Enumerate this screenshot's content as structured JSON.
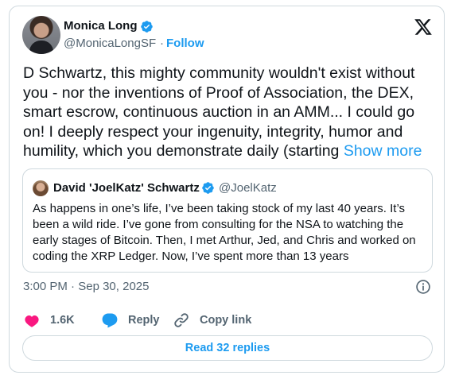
{
  "author": {
    "name": "Monica Long",
    "handle": "@MonicaLongSF",
    "separator": "·",
    "follow_label": "Follow"
  },
  "tweet": {
    "text": "D Schwartz, this mighty community wouldn't exist without you - nor the inventions of Proof of Association, the DEX, smart escrow, continuous auction in an AMM... I could go on! I deeply respect your ingenuity, integrity, humor and humility, which you demonstrate daily (starting ",
    "show_more": "Show more"
  },
  "quoted": {
    "name": "David 'JoelKatz' Schwartz",
    "handle": "@JoelKatz",
    "text": "As happens in one’s life, I’ve been taking stock of my last 40 years. It’s been a wild ride. I’ve gone from consulting for the NSA to watching the early stages of Bitcoin. Then, I met Arthur, Jed, and Chris and worked on coding the XRP Ledger. Now, I’ve spent more than 13 years"
  },
  "meta": {
    "time": "3:00 PM",
    "separator": "·",
    "date": "Sep 30, 2025"
  },
  "actions": {
    "likes": "1.6K",
    "reply_label": "Reply",
    "copy_label": "Copy link"
  },
  "read_replies_label": "Read 32 replies",
  "colors": {
    "accent": "#1d9bf0",
    "like": "#f91880",
    "muted": "#536471",
    "border": "#cfd9de"
  },
  "icons": [
    "verified-badge-icon",
    "x-logo-icon",
    "info-icon",
    "heart-icon",
    "reply-bubble-icon",
    "link-icon"
  ]
}
